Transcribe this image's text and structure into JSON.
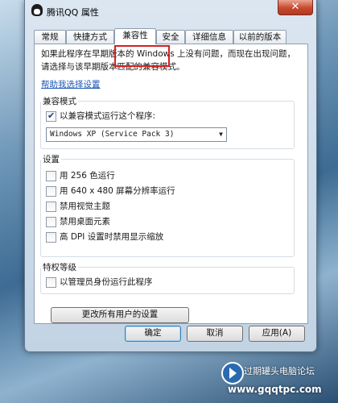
{
  "window": {
    "title": "腾讯QQ 属性",
    "close_glyph": "✕"
  },
  "tabs": [
    {
      "label": "常规"
    },
    {
      "label": "快捷方式"
    },
    {
      "label": "兼容性"
    },
    {
      "label": "安全"
    },
    {
      "label": "详细信息"
    },
    {
      "label": "以前的版本"
    }
  ],
  "active_tab": "兼容性",
  "description": "如果此程序在早期版本的 Windows 上没有问题，而现在出现问题，请选择与该早期版本匹配的兼容模式。",
  "help_link": "帮助我选择设置",
  "compat_mode": {
    "title": "兼容模式",
    "checkbox_label": "以兼容模式运行这个程序:",
    "checked": true,
    "selected_os": "Windows XP (Service Pack 3)"
  },
  "settings": {
    "title": "设置",
    "options": [
      {
        "label": "用 256 色运行",
        "checked": false
      },
      {
        "label": "用 640 x 480 屏幕分辨率运行",
        "checked": false
      },
      {
        "label": "禁用视觉主题",
        "checked": false
      },
      {
        "label": "禁用桌面元素",
        "checked": false
      },
      {
        "label": "高 DPI 设置时禁用显示缩放",
        "checked": false
      }
    ]
  },
  "privilege": {
    "title": "特权等级",
    "checkbox_label": "以管理员身份运行此程序",
    "checked": false
  },
  "buttons": {
    "change_all_users": "更改所有用户的设置",
    "ok": "确定",
    "cancel": "取消",
    "apply": "应用(A)"
  },
  "watermark": {
    "line1": "过期罐头电脑论坛",
    "line2": "www.gqqtpc.com"
  },
  "colors": {
    "highlight": "#d61f1f",
    "link": "#1c56b5"
  }
}
